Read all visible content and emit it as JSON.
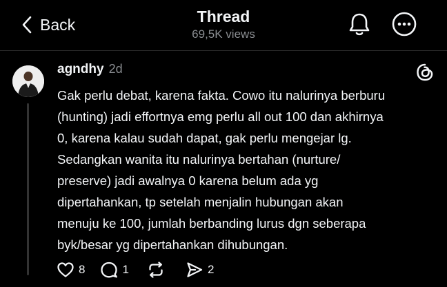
{
  "header": {
    "back_label": "Back",
    "title": "Thread",
    "views": "69,5K views"
  },
  "post": {
    "username": "agndhy",
    "time_ago": "2d",
    "text": "Gak perlu debat, karena fakta. Cowo itu nalurinya berburu\n(hunting) jadi effortnya emg perlu all out 100 dan akhirnya\n0, karena kalau sudah dapat, gak perlu mengejar lg.\nSedangkan wanita itu nalurinya bertahan (nurture/\npreserve) jadi awalnya 0 karena belum ada yg\ndipertahankan, tp setelah menjalin hubungan akan\nmenuju ke 100, jumlah berbanding lurus dgn seberapa\nbyk/besar yg dipertahankan dihubungan.",
    "actions": {
      "likes": "8",
      "replies": "1",
      "shares": "2"
    }
  },
  "icons": {
    "back": "chevron-left-icon",
    "notifications": "bell-icon",
    "more": "more-circle-icon",
    "brand": "threads-logo-icon",
    "like": "heart-icon",
    "reply": "comment-icon",
    "repost": "repost-icon",
    "share": "send-icon"
  },
  "colors": {
    "background": "#000000",
    "text": "#f3f5f7",
    "secondary_text": "#8a8d91"
  }
}
